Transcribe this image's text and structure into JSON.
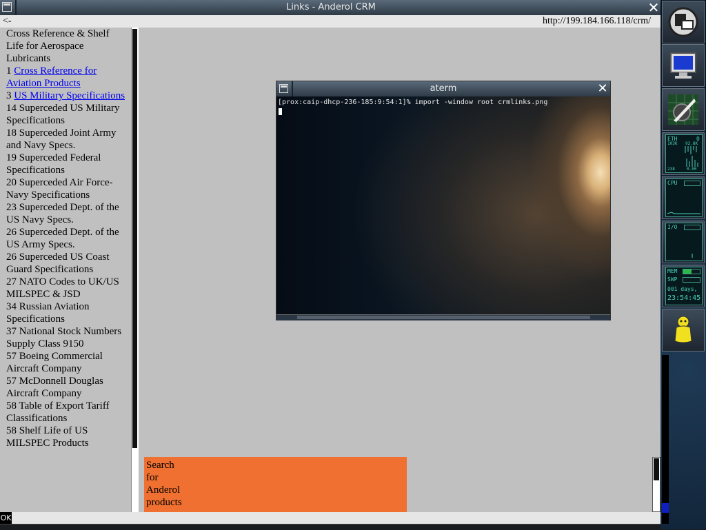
{
  "window": {
    "title": "Links - Anderol CRM",
    "close_glyph": "✕"
  },
  "urlbar": {
    "back": "<-",
    "url": "http://199.184.166.118/crm/"
  },
  "sidebar": {
    "heading": "Cross Reference & Shelf Life for Aerospace Lubricants",
    "items": [
      {
        "page": "1",
        "text": "Cross Reference for Aviation Products",
        "link": true
      },
      {
        "page": "3",
        "text": "US Military Specifications",
        "link": true
      },
      {
        "page": "14",
        "text": "Superceded US Military Specifications",
        "link": false
      },
      {
        "page": "18",
        "text": "Superceded Joint Army and Navy Specs.",
        "link": false
      },
      {
        "page": "19",
        "text": "Superceded Federal Specifications",
        "link": false
      },
      {
        "page": "20",
        "text": "Superceded Air Force-Navy Specifications",
        "link": false
      },
      {
        "page": "23",
        "text": "Superceded Dept. of the US Navy Specs.",
        "link": false
      },
      {
        "page": "26",
        "text": "Superceded Dept. of the US Army Specs.",
        "link": false
      },
      {
        "page": "26",
        "text": "Superceded US Coast Guard Specifications",
        "link": false
      },
      {
        "page": "27",
        "text": "NATO Codes to UK/US MILSPEC & JSD",
        "link": false
      },
      {
        "page": "34",
        "text": "Russian Aviation Specifications",
        "link": false
      },
      {
        "page": "37",
        "text": "National Stock Numbers Supply Class 9150",
        "link": false
      },
      {
        "page": "57",
        "text": "Boeing Commercial Aircraft Company",
        "link": false
      },
      {
        "page": "57",
        "text": "McDonnell Douglas Aircraft Company",
        "link": false
      },
      {
        "page": "58",
        "text": "Table of Export Tariff Classifications",
        "link": false
      },
      {
        "page": "58",
        "text": "Shelf Life of US MILSPEC Products",
        "link": false
      }
    ]
  },
  "search": {
    "text": "Search for Anderol products"
  },
  "status": {
    "ok": "OK"
  },
  "aterm": {
    "title": "aterm",
    "close_glyph": "✕",
    "command_line": "[prox:caip-dhcp-236-185:9:54:1]% import -window root crmlinks.png"
  },
  "dock": {
    "net_label": "ETH",
    "net_number": "0",
    "net_rx": "103K",
    "net_tx": "92.8K",
    "net_bottom_left": "238",
    "net_bottom_right": "0.00",
    "cpu_label": "CPU",
    "io_label": "I/O",
    "mem_label": "MEM",
    "swp_label": "SWP",
    "uptime_days": "001 days,",
    "clock": "23:54:45"
  }
}
